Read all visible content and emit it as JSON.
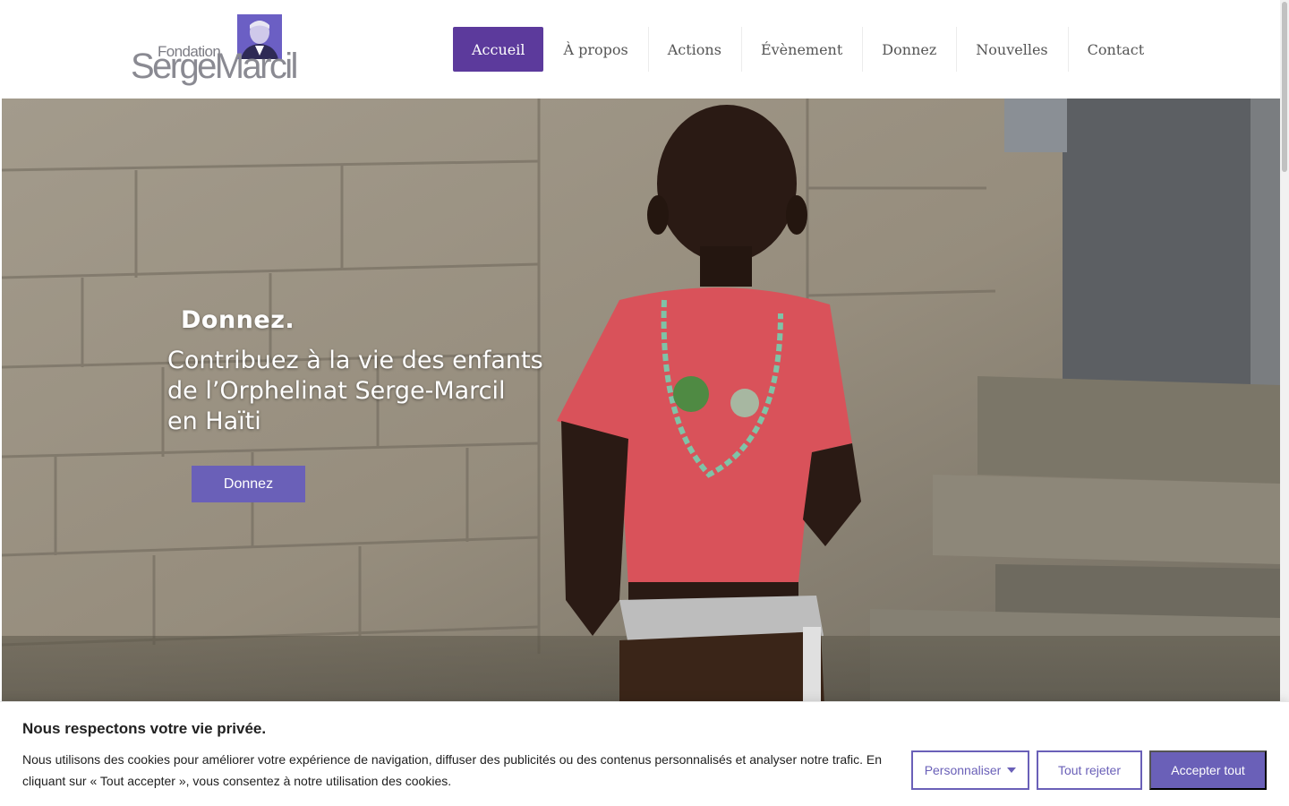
{
  "header": {
    "logo": {
      "small_word": "Fondation",
      "big_word": "SergeMarcil",
      "accent": "#6b5fc4"
    },
    "nav": [
      {
        "label": "Accueil",
        "active": true
      },
      {
        "label": "À propos",
        "active": false
      },
      {
        "label": "Actions",
        "active": false
      },
      {
        "label": "Évènement",
        "active": false
      },
      {
        "label": "Donnez",
        "active": false
      },
      {
        "label": "Nouvelles",
        "active": false
      },
      {
        "label": "Contact",
        "active": false
      }
    ]
  },
  "hero": {
    "title": "Donnez.",
    "lines": [
      "Contribuez à la vie des enfants",
      "de l’Orphelinat Serge-Marcil",
      "en Haïti"
    ],
    "button_label": "Donnez"
  },
  "cookie": {
    "title": "Nous respectons votre vie privée.",
    "text": "Nous utilisons des cookies pour améliorer votre expérience de navigation, diffuser des publicités ou des contenus personnalisés et analyser notre trafic. En cliquant sur « Tout accepter », vous consentez à notre utilisation des cookies.",
    "customize_label": "Personnaliser",
    "reject_label": "Tout rejeter",
    "accept_label": "Accepter tout"
  },
  "colors": {
    "brand_purple": "#5c3a9c",
    "button_purple": "#6a60b8",
    "text_dark": "#212121"
  }
}
